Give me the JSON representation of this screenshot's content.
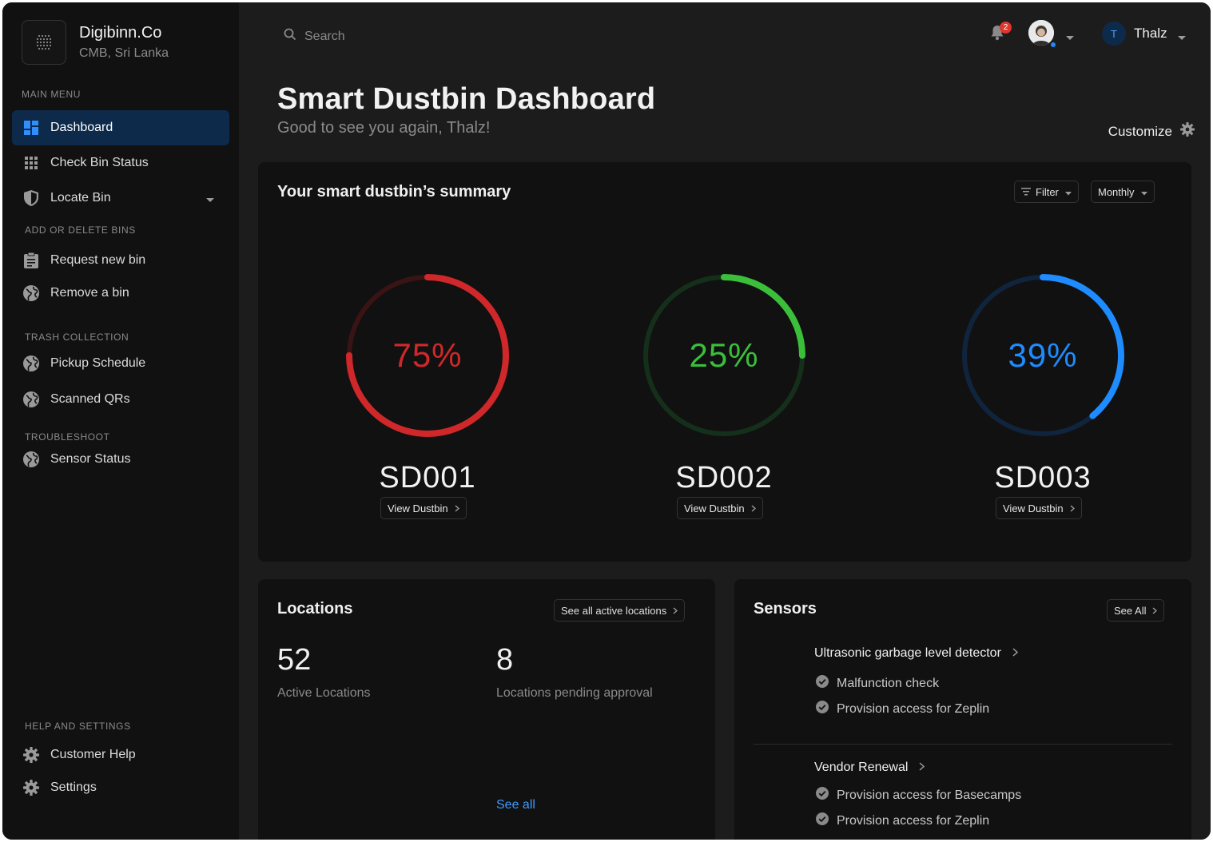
{
  "brand": {
    "name": "Digibinn.Co",
    "location": "CMB, Sri Lanka"
  },
  "sidebar": {
    "main_menu_title": "MAIN MENU",
    "main_items": [
      {
        "label": "Dashboard",
        "icon": "dashboard-icon",
        "active": true
      },
      {
        "label": "Check Bin Status",
        "icon": "grid-icon"
      },
      {
        "label": "Locate Bin",
        "icon": "shield-icon",
        "has_dropdown": true
      }
    ],
    "add_delete_title": "ADD OR DELETE BINS",
    "add_delete_items": [
      {
        "label": "Request new bin",
        "icon": "clipboard-icon"
      },
      {
        "label": "Remove a bin",
        "icon": "globe-icon"
      }
    ],
    "trash_title": "TRASH COLLECTION",
    "trash_items": [
      {
        "label": "Pickup Schedule",
        "icon": "globe-icon"
      },
      {
        "label": "Scanned QRs",
        "icon": "globe-icon"
      }
    ],
    "troubleshoot_title": "TROUBLESHOOT",
    "troubleshoot_items": [
      {
        "label": "Sensor Status",
        "icon": "globe-icon"
      }
    ],
    "help_title": "HELP AND SETTINGS",
    "help_items": [
      {
        "label": "Customer Help",
        "icon": "gear-icon"
      },
      {
        "label": "Settings",
        "icon": "gear-icon"
      }
    ]
  },
  "topbar": {
    "search_placeholder": "Search",
    "notification_count": "2",
    "user_initial": "T",
    "user_name": "Thalz"
  },
  "header": {
    "title": "Smart Dustbin Dashboard",
    "subtitle": "Good to see you again, Thalz!",
    "customize_label": "Customize"
  },
  "summary": {
    "title": "Your smart dustbin’s summary",
    "filter_label": "Filter",
    "period_label": "Monthly",
    "bins": [
      {
        "id": "SD001",
        "percent": 75,
        "percent_label": "75%",
        "color": "#d0282a",
        "track": "#3a1414",
        "button": "View Dustbin"
      },
      {
        "id": "SD002",
        "percent": 25,
        "percent_label": "25%",
        "color": "#3bbf3b",
        "track": "#15301a",
        "button": "View Dustbin"
      },
      {
        "id": "SD003",
        "percent": 39,
        "percent_label": "39%",
        "color": "#1e8bff",
        "track": "#10243e",
        "button": "View Dustbin"
      }
    ]
  },
  "locations": {
    "title": "Locations",
    "see_all_button": "See all active locations",
    "active_count": "52",
    "active_label": "Active Locations",
    "pending_count": "8",
    "pending_label": "Locations pending approval",
    "see_all_link": "See all"
  },
  "sensors": {
    "title": "Sensors",
    "see_all_button": "See All",
    "groups": [
      {
        "title": "Ultrasonic garbage level detector",
        "items": [
          "Malfunction check",
          "Provision access for Zeplin"
        ]
      },
      {
        "title": "Vendor Renewal",
        "items": [
          "Provision access for Basecamps",
          "Provision access for Zeplin"
        ]
      }
    ]
  },
  "colors": {
    "accent": "#1e88ff",
    "active_nav": "#0d2a4a",
    "card": "#111111",
    "background": "#1c1c1c"
  }
}
